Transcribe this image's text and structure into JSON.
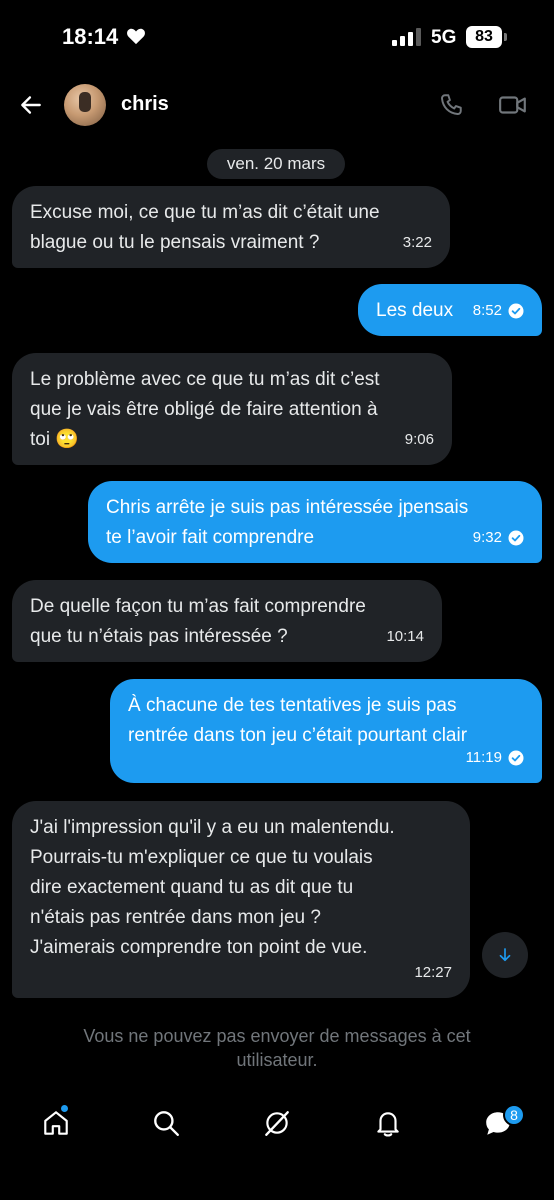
{
  "status_bar": {
    "time": "18:14",
    "network": "5G",
    "battery": "83"
  },
  "header": {
    "contact_name": "chris"
  },
  "conversation": {
    "date_label": "ven. 20 mars",
    "messages": [
      {
        "direction": "in",
        "text": "Excuse moi, ce que tu m’as dit c’était une\nblague ou tu le pensais vraiment ?",
        "time": "3:22"
      },
      {
        "direction": "out",
        "text": "Les deux",
        "time": "8:52",
        "read": true
      },
      {
        "direction": "in",
        "text": "Le problème avec ce que tu m’as dit c’est\nque je vais être obligé de faire attention à\ntoi 🙄",
        "time": "9:06"
      },
      {
        "direction": "out",
        "text": "Chris arrête je suis pas intéressée jpensais\nte l’avoir fait comprendre",
        "time": "9:32",
        "read": true
      },
      {
        "direction": "in",
        "text": "De quelle façon tu m’as fait comprendre\nque tu n’étais pas intéressée ?",
        "time": "10:14"
      },
      {
        "direction": "out",
        "text": "À chacune de tes tentatives je suis pas\nrentrée dans ton jeu c’était pourtant clair",
        "time": "11:19",
        "read": true
      },
      {
        "direction": "in",
        "text": "J'ai l'impression qu'il y a eu un malentendu.\nPourrais-tu m'expliquer ce que tu voulais\ndire exactement quand tu as dit que tu\nn'étais pas rentrée dans mon jeu ?\nJ'aimerais comprendre ton point de vue.",
        "time": "12:27"
      }
    ]
  },
  "blocked_notice": "Vous ne pouvez pas envoyer de messages à cet\nutilisateur.",
  "bottom_nav": {
    "messages_badge": "8"
  },
  "colors": {
    "accent": "#1d9bf0",
    "incoming_bubble": "#202327",
    "background": "#000000",
    "muted_text": "#71767b"
  },
  "icons": [
    "back-arrow-icon",
    "phone-icon",
    "video-camera-icon",
    "read-check-icon",
    "arrow-down-icon",
    "home-icon",
    "search-icon",
    "grok-icon",
    "bell-icon",
    "messages-icon"
  ]
}
